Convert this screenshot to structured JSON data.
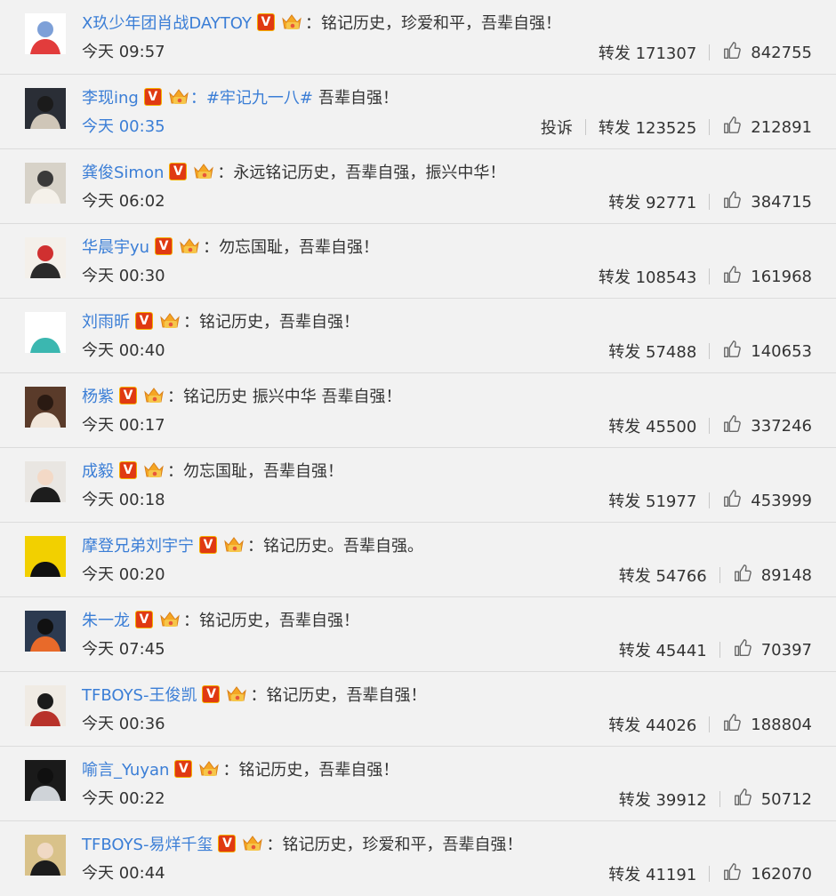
{
  "comments": [
    {
      "name": "X玖少年团肖战DAYTOY",
      "colon": "：",
      "comment": "铭记历史，珍爱和平，吾辈自强！",
      "hashtag": "",
      "time": "今天 09:57",
      "time_blue": false,
      "report": "",
      "repost": "转发 171307",
      "likes": "842755",
      "avatar_colors": [
        "#ffffff",
        "#e23c3c",
        "#7da0d8"
      ]
    },
    {
      "name": "李现ing",
      "colon": "",
      "comment": "吾辈自强！",
      "hashtag": "：#牢记九一八#",
      "time": "今天 00:35",
      "time_blue": true,
      "report": "投诉",
      "repost": "转发 123525",
      "likes": "212891",
      "avatar_colors": [
        "#2a2e36",
        "#cfc6b8",
        "#1b1b1b"
      ]
    },
    {
      "name": "龚俊Simon",
      "colon": "：",
      "comment": "永远铭记历史，吾辈自强，振兴中华！",
      "hashtag": "",
      "time": "今天 06:02",
      "time_blue": false,
      "report": "",
      "repost": "转发 92771",
      "likes": "384715",
      "avatar_colors": [
        "#d7d2c8",
        "#f5f1ea",
        "#3a3a3a"
      ]
    },
    {
      "name": "华晨宇yu",
      "colon": "：",
      "comment": "勿忘国耻，吾辈自强！",
      "hashtag": "",
      "time": "今天 00:30",
      "time_blue": false,
      "report": "",
      "repost": "转发 108543",
      "likes": "161968",
      "avatar_colors": [
        "#f4f0ea",
        "#2b2b2b",
        "#d03030"
      ]
    },
    {
      "name": "刘雨昕",
      "colon": "：",
      "comment": "铭记历史，吾辈自强！",
      "hashtag": "",
      "time": "今天 00:40",
      "time_blue": false,
      "report": "",
      "repost": "转发 57488",
      "likes": "140653",
      "avatar_colors": [
        "#ffffff",
        "#3bb7b0",
        "#ffffff"
      ]
    },
    {
      "name": "杨紫",
      "colon": "：",
      "comment": "铭记历史 振兴中华 吾辈自强！",
      "hashtag": "",
      "time": "今天 00:17",
      "time_blue": false,
      "report": "",
      "repost": "转发 45500",
      "likes": "337246",
      "avatar_colors": [
        "#5a3b2a",
        "#f1e6da",
        "#2a1a12"
      ]
    },
    {
      "name": "成毅",
      "colon": "：",
      "comment": "勿忘国耻，吾辈自强！",
      "hashtag": "",
      "time": "今天 00:18",
      "time_blue": false,
      "report": "",
      "repost": "转发 51977",
      "likes": "453999",
      "avatar_colors": [
        "#e9e6e2",
        "#1d1d1d",
        "#f3d9c6"
      ]
    },
    {
      "name": "摩登兄弟刘宇宁",
      "colon": "：",
      "comment": "铭记历史。吾辈自强。",
      "hashtag": "",
      "time": "今天 00:20",
      "time_blue": false,
      "report": "",
      "repost": "转发 54766",
      "likes": "89148",
      "avatar_colors": [
        "#f2d000",
        "#111111",
        "#f2d000"
      ]
    },
    {
      "name": "朱一龙",
      "colon": "：",
      "comment": "铭记历史，吾辈自强！",
      "hashtag": "",
      "time": "今天 07:45",
      "time_blue": false,
      "report": "",
      "repost": "转发 45441",
      "likes": "70397",
      "avatar_colors": [
        "#2c3a50",
        "#e86a2a",
        "#111111"
      ]
    },
    {
      "name": "TFBOYS-王俊凯",
      "colon": "：",
      "comment": "铭记历史，吾辈自强！",
      "hashtag": "",
      "time": "今天 00:36",
      "time_blue": false,
      "report": "",
      "repost": "转发 44026",
      "likes": "188804",
      "avatar_colors": [
        "#f0ebe4",
        "#b8322a",
        "#1b1b1b"
      ]
    },
    {
      "name": "喻言_Yuyan",
      "colon": "：",
      "comment": "铭记历史，吾辈自强！",
      "hashtag": "",
      "time": "今天 00:22",
      "time_blue": false,
      "report": "",
      "repost": "转发 39912",
      "likes": "50712",
      "avatar_colors": [
        "#1a1a1a",
        "#cfd3d8",
        "#101010"
      ]
    },
    {
      "name": "TFBOYS-易烊千玺",
      "colon": "：",
      "comment": "铭记历史，珍爱和平，吾辈自强！",
      "hashtag": "",
      "time": "今天 00:44",
      "time_blue": false,
      "report": "",
      "repost": "转发 41191",
      "likes": "162070",
      "avatar_colors": [
        "#d9c28a",
        "#1c1c1c",
        "#f0d9c4"
      ]
    }
  ],
  "icons": {
    "verified": "verified-v-icon",
    "fan": "fan-crown-icon",
    "like": "thumbs-up-icon"
  },
  "badge_text": "V",
  "colors": {
    "link": "#3b7ed6",
    "verified": "#e03a12",
    "background": "#f2f2f2"
  }
}
